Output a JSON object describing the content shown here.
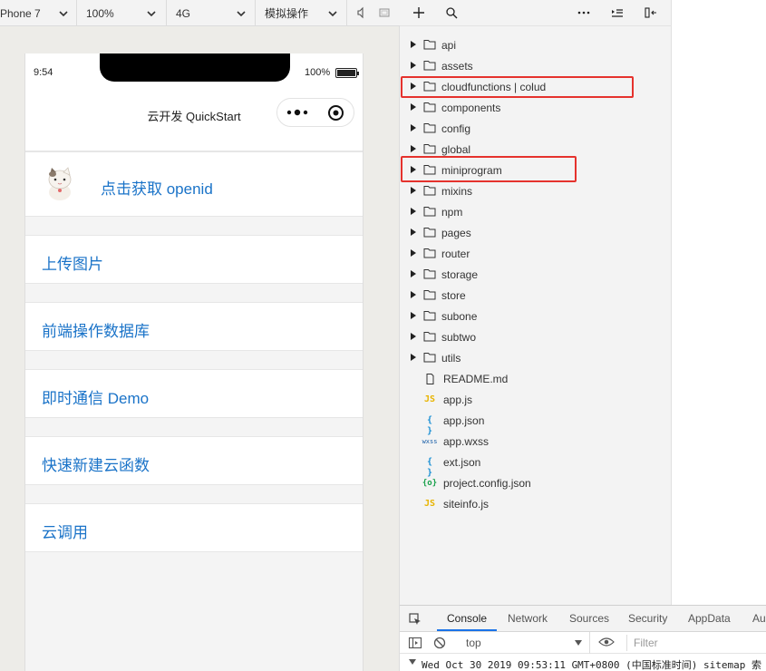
{
  "simulator_toolbar": {
    "device": "Phone 7",
    "zoom": "100%",
    "network": "4G",
    "operation": "模拟操作"
  },
  "phone": {
    "status_time": "9:54",
    "battery": "100%",
    "nav_title": "云开发 QuickStart",
    "rows": {
      "openid": "点击获取 openid",
      "upload": "上传图片",
      "database": "前端操作数据库",
      "im": "即时通信 Demo",
      "cloud_function": "快速新建云函数",
      "cloud_call": "云调用"
    }
  },
  "explorer": {
    "folders": [
      "api",
      "assets",
      "cloudfunctions | colud",
      "components",
      "config",
      "global",
      "miniprogram",
      "mixins",
      "npm",
      "pages",
      "router",
      "storage",
      "store",
      "subone",
      "subtwo",
      "utils"
    ],
    "files": [
      {
        "name": "README.md",
        "icon": "file-icon"
      },
      {
        "name": "app.js",
        "icon": "js-file-icon",
        "glyph": "JS"
      },
      {
        "name": "app.json",
        "icon": "json-file-icon",
        "glyph": "{ }"
      },
      {
        "name": "app.wxss",
        "icon": "wxss-file-icon",
        "glyph": "wxss"
      },
      {
        "name": "ext.json",
        "icon": "json-file-icon",
        "glyph": "{ }"
      },
      {
        "name": "project.config.json",
        "icon": "project-config-icon",
        "glyph": "{o}"
      },
      {
        "name": "siteinfo.js",
        "icon": "js-file-icon",
        "glyph": "JS"
      }
    ]
  },
  "console": {
    "tabs": [
      "Console",
      "Network",
      "Sources",
      "Security",
      "AppData",
      "Au"
    ],
    "active_tab": "Console",
    "context": "top",
    "filter_placeholder": "Filter",
    "log": "Wed Oct 30 2019 09:53:11 GMT+0800 (中国标准时间) sitemap 索"
  },
  "colors": {
    "link_blue": "#1a73c8",
    "highlight_red": "#e5322d",
    "tab_accent": "#1a73e8"
  }
}
